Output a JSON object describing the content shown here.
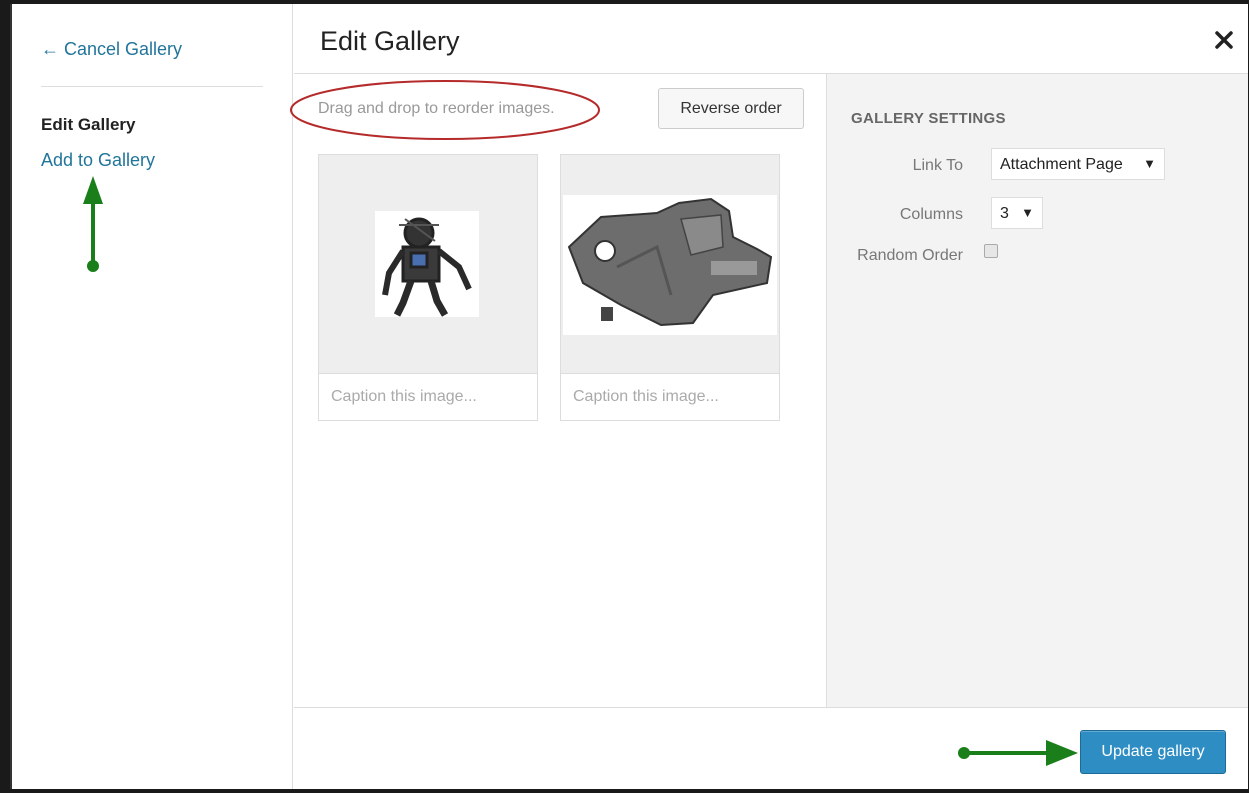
{
  "sidebar": {
    "cancel_link": "← Cancel Gallery",
    "active_item": "Edit Gallery",
    "add_link": "Add to Gallery"
  },
  "header": {
    "title": "Edit Gallery",
    "close_icon": "close-icon"
  },
  "content": {
    "drag_hint": "Drag and drop to reorder images.",
    "reverse_label": "Reverse order",
    "images": [
      {
        "caption_placeholder": "Caption this image...",
        "subject": "robot"
      },
      {
        "caption_placeholder": "Caption this image...",
        "subject": "metal part"
      }
    ]
  },
  "settings": {
    "title": "GALLERY SETTINGS",
    "link_to_label": "Link To",
    "link_to_value": "Attachment Page",
    "columns_label": "Columns",
    "columns_value": "3",
    "random_order_label": "Random Order",
    "random_order_checked": false
  },
  "footer": {
    "update_label": "Update gallery"
  },
  "colors": {
    "link": "#21759b",
    "primary_button": "#2e8ec4",
    "annotation_arrow": "#1a7f1a",
    "annotation_ellipse": "#b52a2a"
  }
}
